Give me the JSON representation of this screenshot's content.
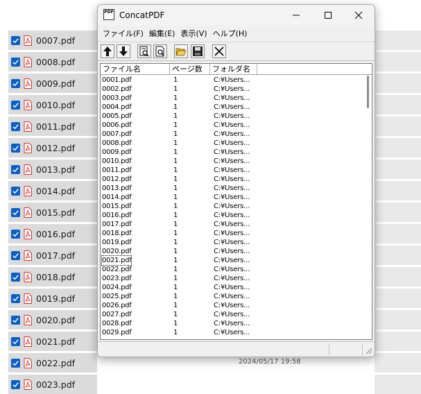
{
  "window": {
    "title": "ConcatPDF",
    "app_icon_text": "PDF",
    "menu": [
      {
        "label": "ファイル(F)"
      },
      {
        "label": "編集(E)"
      },
      {
        "label": "表示(V)"
      },
      {
        "label": "ヘルプ(H)"
      }
    ],
    "columns": [
      {
        "label": "ファイル名"
      },
      {
        "label": "ページ数"
      },
      {
        "label": "フォルダ名"
      }
    ],
    "rows": [
      {
        "name": "0001.pdf",
        "pages": "1",
        "folder": "C:¥Users..."
      },
      {
        "name": "0002.pdf",
        "pages": "1",
        "folder": "C:¥Users..."
      },
      {
        "name": "0003.pdf",
        "pages": "1",
        "folder": "C:¥Users..."
      },
      {
        "name": "0004.pdf",
        "pages": "1",
        "folder": "C:¥Users..."
      },
      {
        "name": "0005.pdf",
        "pages": "1",
        "folder": "C:¥Users..."
      },
      {
        "name": "0006.pdf",
        "pages": "1",
        "folder": "C:¥Users..."
      },
      {
        "name": "0007.pdf",
        "pages": "1",
        "folder": "C:¥Users..."
      },
      {
        "name": "0008.pdf",
        "pages": "1",
        "folder": "C:¥Users..."
      },
      {
        "name": "0009.pdf",
        "pages": "1",
        "folder": "C:¥Users..."
      },
      {
        "name": "0010.pdf",
        "pages": "1",
        "folder": "C:¥Users..."
      },
      {
        "name": "0011.pdf",
        "pages": "1",
        "folder": "C:¥Users..."
      },
      {
        "name": "0012.pdf",
        "pages": "1",
        "folder": "C:¥Users..."
      },
      {
        "name": "0013.pdf",
        "pages": "1",
        "folder": "C:¥Users..."
      },
      {
        "name": "0014.pdf",
        "pages": "1",
        "folder": "C:¥Users..."
      },
      {
        "name": "0015.pdf",
        "pages": "1",
        "folder": "C:¥Users..."
      },
      {
        "name": "0016.pdf",
        "pages": "1",
        "folder": "C:¥Users..."
      },
      {
        "name": "0017.pdf",
        "pages": "1",
        "folder": "C:¥Users..."
      },
      {
        "name": "0018.pdf",
        "pages": "1",
        "folder": "C:¥Users..."
      },
      {
        "name": "0019.pdf",
        "pages": "1",
        "folder": "C:¥Users..."
      },
      {
        "name": "0020.pdf",
        "pages": "1",
        "folder": "C:¥Users..."
      },
      {
        "name": "0021.pdf",
        "pages": "1",
        "folder": "C:¥Users..."
      },
      {
        "name": "0022.pdf",
        "pages": "1",
        "folder": "C:¥Users..."
      },
      {
        "name": "0023.pdf",
        "pages": "1",
        "folder": "C:¥Users..."
      },
      {
        "name": "0024.pdf",
        "pages": "1",
        "folder": "C:¥Users..."
      },
      {
        "name": "0025.pdf",
        "pages": "1",
        "folder": "C:¥Users..."
      },
      {
        "name": "0026.pdf",
        "pages": "1",
        "folder": "C:¥Users..."
      },
      {
        "name": "0027.pdf",
        "pages": "1",
        "folder": "C:¥Users..."
      },
      {
        "name": "0028.pdf",
        "pages": "1",
        "folder": "C:¥Users..."
      },
      {
        "name": "0029.pdf",
        "pages": "1",
        "folder": "C:¥Users..."
      }
    ],
    "focused_row": "0021.pdf"
  },
  "explorer": {
    "files": [
      {
        "name": "0007.pdf"
      },
      {
        "name": "0008.pdf"
      },
      {
        "name": "0009.pdf"
      },
      {
        "name": "0010.pdf"
      },
      {
        "name": "0011.pdf"
      },
      {
        "name": "0012.pdf"
      },
      {
        "name": "0013.pdf"
      },
      {
        "name": "0014.pdf"
      },
      {
        "name": "0015.pdf"
      },
      {
        "name": "0016.pdf"
      },
      {
        "name": "0017.pdf"
      },
      {
        "name": "0018.pdf"
      },
      {
        "name": "0019.pdf"
      },
      {
        "name": "0020.pdf"
      },
      {
        "name": "0021.pdf"
      },
      {
        "name": "0022.pdf"
      },
      {
        "name": "0023.pdf"
      }
    ],
    "visible_date": "2024/05/17 19:58"
  },
  "colors": {
    "checkbox": "#0a5fc5",
    "pdf_icon": "#d9302c",
    "row_bg": "#dbdbdb"
  }
}
